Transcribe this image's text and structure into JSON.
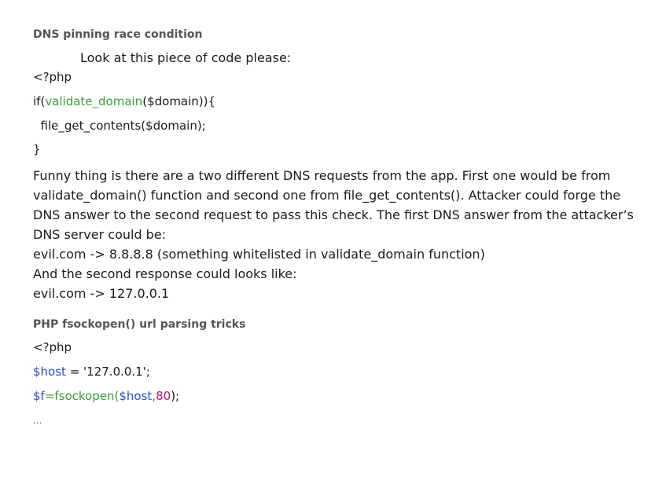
{
  "section1": {
    "title": "DNS pinning race condition",
    "intro": "Look at this piece of code please:",
    "code": {
      "line1": "<?php",
      "line2_fn": "validate_domain",
      "line2_prefix": "if(",
      "line2_suffix": "($domain)){",
      "line3": "  file_get_contents($domain);",
      "line4": "}"
    },
    "paragraph": "Funny thing is there are a two different DNS requests from the app. First one would be from validate_domain() function and second one from file_get_contents(). Attacker could forge the DNS answer to the second request to pass this check. The first DNS answer from the attacker’s DNS server could be:",
    "example1": "evil.com -> 8.8.8.8 (something whitelisted in validate_domain function)",
    "transition": "And the second response could looks like:",
    "example2": "evil.com -> 127.0.0.1"
  },
  "section2": {
    "title": "PHP fsockopen() url parsing tricks",
    "code": {
      "line1": "<?php",
      "line2_var": "$host",
      "line2_rest": " = '127.0.0.1';",
      "line3_var": "$f",
      "line3_eq": "=",
      "line3_fn": "fsockopen(",
      "line3_arg": "$host",
      "line3_comma": ",",
      "line3_num": "80",
      "line3_end": ");",
      "ellipsis": "..."
    }
  },
  "colors": {
    "code_function": "#3e9b3e",
    "code_variable": "#2a50c8",
    "code_number": "#b0176b",
    "heading": "#555555"
  }
}
